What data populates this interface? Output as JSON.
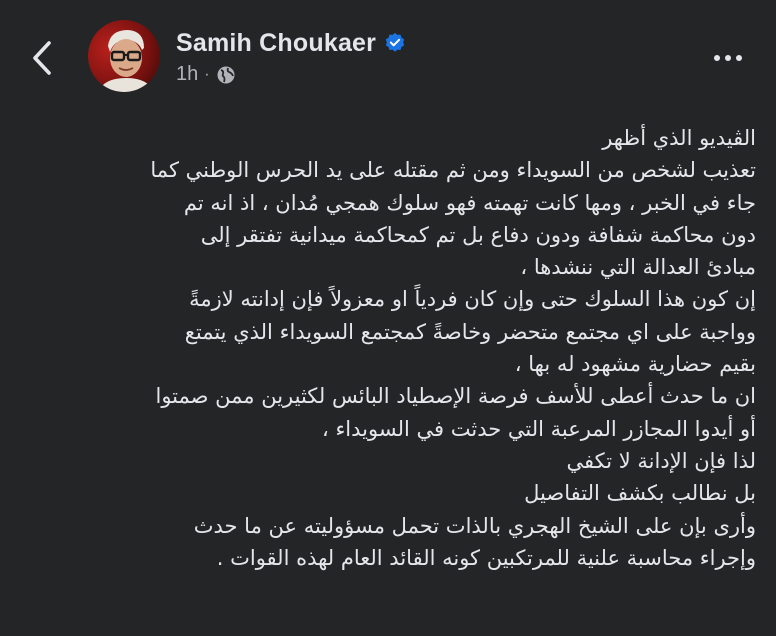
{
  "header": {
    "author_name": "Samih Choukaer",
    "verified": true,
    "timestamp": "1h",
    "separator": "·",
    "audience_icon": "globe-icon",
    "back_icon": "chevron-left-icon",
    "more_icon": "more-horizontal-icon",
    "colors": {
      "verified_badge": "#1b74e4",
      "background": "#242526",
      "text_primary": "#e4e6eb",
      "text_secondary": "#b0b3b8"
    }
  },
  "post": {
    "lines": [
      "الڤيديو الذي أظهر",
      "تعذيب لشخص من السويداء ومن ثم مقتله على يد الحرس الوطني كما",
      "جاء في الخبر ، ومها كانت تهمته فهو سلوك همجي مُدان ، اذ انه تم",
      "دون محاكمة شفافة ودون دفاع بل تم كمحاكمة ميدانية تفتقر إلى",
      "مبادئ العدالة التي ننشدها ،",
      "إن كون هذا السلوك حتى وإن كان فردياً او معزولاً فإن إدانته لازمةً",
      "وواجبة  على اي مجتمع متحضر وخاصةً كمجتمع السويداء الذي يتمتع",
      "بقيم حضارية مشهود له بها ،",
      "ان ما حدث  أعطى للأسف فرصة الإصطياد البائس لكثيرين ممن صمتوا",
      "أو أيدوا المجازر المرعبة التي حدثت في السويداء ،",
      "لذا فإن الإدانة لا تكفي",
      "بل نطالب بكشف التفاصيل",
      "وأرى بإن على الشيخ الهجري بالذات تحمل مسؤوليته عن ما حدث",
      "وإجراء محاسبة علنية للمرتكبين كونه القائد العام لهذه القوات ."
    ]
  }
}
